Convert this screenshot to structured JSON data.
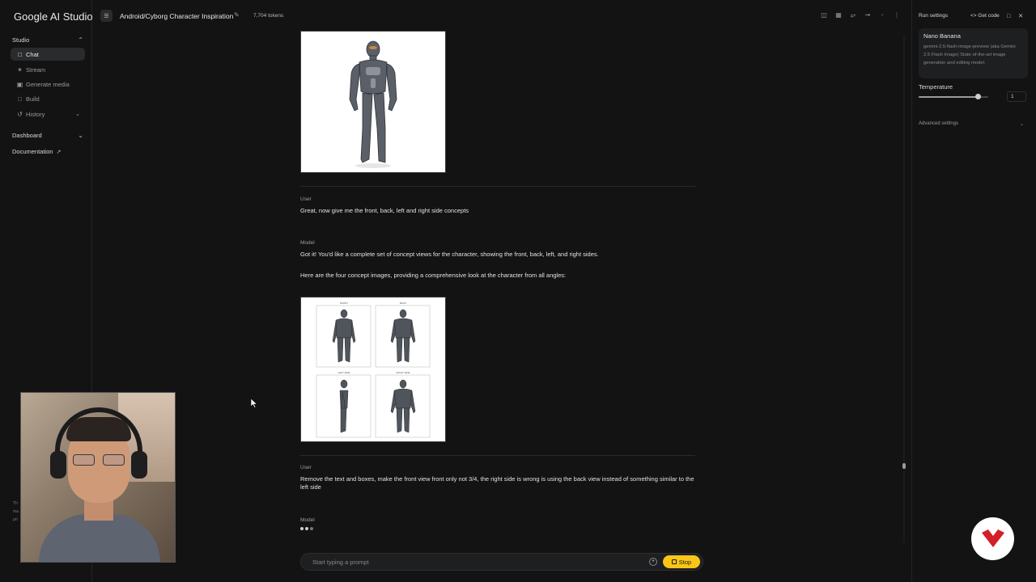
{
  "brand": "Google AI Studio",
  "sidebar": {
    "studio_label": "Studio",
    "items": [
      {
        "label": "Chat",
        "icon": "chat-icon"
      },
      {
        "label": "Stream",
        "icon": "stream-icon"
      },
      {
        "label": "Generate media",
        "icon": "media-icon"
      },
      {
        "label": "Build",
        "icon": "build-icon"
      },
      {
        "label": "History",
        "icon": "history-icon"
      }
    ],
    "dashboard_label": "Dashboard",
    "documentation_label": "Documentation"
  },
  "header": {
    "title": "Android/Cyborg Character Inspiration",
    "tokens": "7,704 tokens"
  },
  "chat": {
    "messages": [
      {
        "role": "User",
        "text": "Great, now give me the front, back, left and right side concepts"
      },
      {
        "role": "Model",
        "text1": "Got it! You'd like a complete set of concept views for the character, showing the front, back, left, and right sides.",
        "text2": "Here are the four concept images, providing a comprehensive look at the character from all angles:"
      },
      {
        "role": "User",
        "text": "Remove the text and boxes, make the front view front only not 3/4, the right side is wrong is using the back view instead of something similar to the left side"
      },
      {
        "role": "Model"
      }
    ],
    "concept_sheet_labels": [
      "FRONT",
      "BACK",
      "LEFT SIDE",
      "RIGHT SIDE"
    ]
  },
  "prompt": {
    "placeholder": "Start typing a prompt",
    "stop_label": "Stop"
  },
  "run_settings": {
    "title": "Run settings",
    "get_code": "Get code",
    "model_name": "Nano Banana",
    "model_desc": "gemini-2.5-flash-image-preview (aka Gemini 2.5 Flash Image) State-of-the-art image generation and editing model.",
    "temperature_label": "Temperature",
    "temperature_value": "1",
    "temperature_fraction": 0.85,
    "advanced_label": "Advanced settings"
  },
  "colors": {
    "background": "#131314",
    "stop_button": "#f9c518",
    "badge_mark": "#d31f26"
  }
}
